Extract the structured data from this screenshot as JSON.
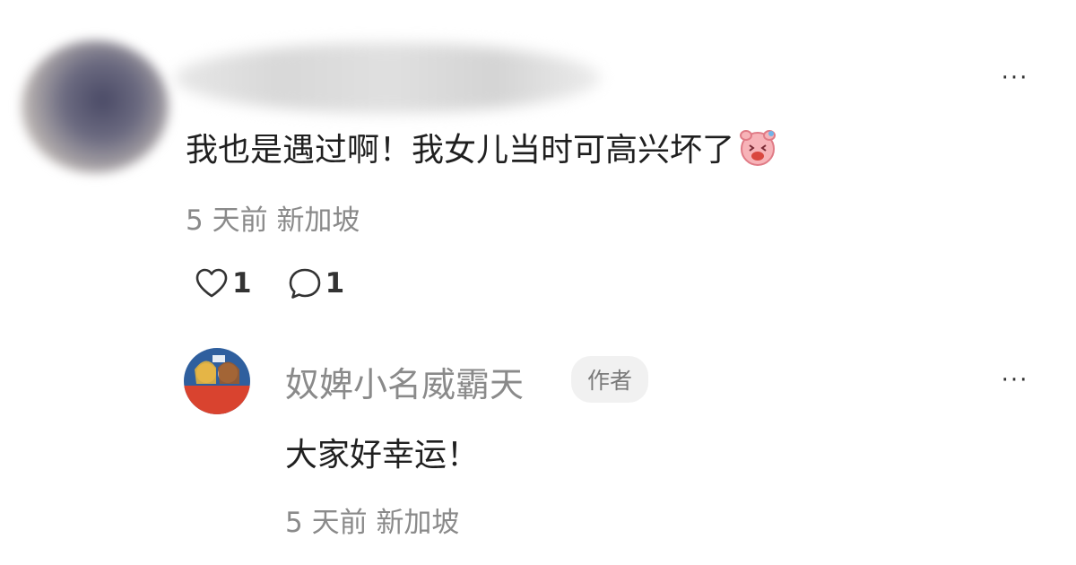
{
  "comment": {
    "text": "我也是遇过啊！我女儿当时可高兴坏了",
    "emoji": "pig-face-emoji",
    "time": "5 天前",
    "location": "新加坡",
    "likes": "1",
    "replies": "1",
    "more_label": "···"
  },
  "reply": {
    "author": "奴婢小名威霸天",
    "badge": "作者",
    "text": "大家好幸运！",
    "time": "5 天前",
    "location": "新加坡",
    "more_label": "···"
  }
}
